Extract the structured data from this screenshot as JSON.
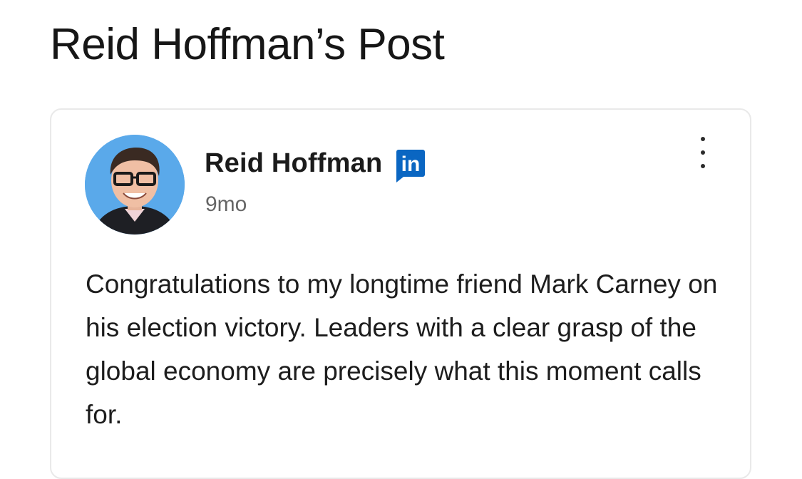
{
  "header": {
    "title": "Reid Hoffman’s Post"
  },
  "post": {
    "author": {
      "name": "Reid Hoffman",
      "avatar_icon": "profile-photo",
      "badge": {
        "text": "in",
        "icon": "linkedin-icon",
        "color": "#0a66c2"
      }
    },
    "time": "9mo",
    "menu_icon": "more-vertical-icon",
    "text": "Congratulations to my longtime friend Mark Carney on his election victory. Leaders with a clear grasp of the global economy are precisely what this moment calls for."
  },
  "colors": {
    "avatar_background": "#5aa9ea",
    "card_border": "#e9e9e9"
  }
}
